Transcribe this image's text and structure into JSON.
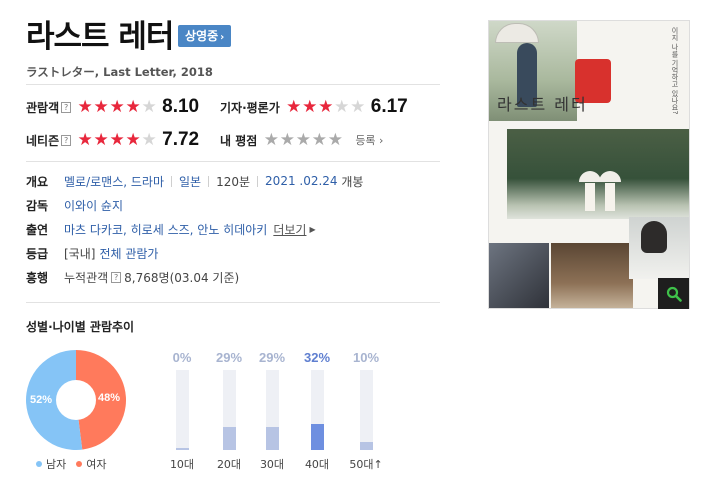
{
  "movie": {
    "title": "라스트 레터",
    "status_badge": "상영중",
    "subtitle": "ラストレター, Last Letter, 2018"
  },
  "ratings": {
    "audience": {
      "label": "관람객",
      "help": "?",
      "score": "8.10",
      "stars_on": 4
    },
    "critics": {
      "label": "기자·평론가",
      "score": "6.17",
      "stars_on": 3
    },
    "netizen": {
      "label": "네티즌",
      "help": "?",
      "score": "7.72",
      "stars_on": 4
    },
    "my": {
      "label": "내 평점",
      "register": "등록 ›"
    }
  },
  "info": {
    "overview": {
      "key": "개요",
      "genres": "멜로/로맨스, 드라마",
      "country": "일본",
      "runtime": "120분",
      "release_date": "2021 .02.24",
      "release_suffix": " 개봉"
    },
    "director": {
      "key": "감독",
      "value": "이와이 슌지"
    },
    "cast": {
      "key": "출연",
      "value": "마츠 다카코, 히로세 스즈, 안노 히데아키",
      "more": "더보기"
    },
    "rating": {
      "key": "등급",
      "prefix": "[국내]",
      "value": "전체 관람가"
    },
    "boxoffice": {
      "key": "흥행",
      "label": "누적관객",
      "help": "?",
      "value": "8,768명(03.04 기준)"
    }
  },
  "poster": {
    "title": "라스트 레터",
    "vertical_text": "이지 나를 기억하고 있나요?",
    "zoom_icon": "search-icon"
  },
  "demographics": {
    "title": "성별·나이별 관람추이",
    "gender": {
      "male_label": "남자",
      "female_label": "여자",
      "male_pct": "52%",
      "female_pct": "48%"
    },
    "colors": {
      "male": "#85c4f6",
      "female": "#ff7a5c",
      "age_bar": "#b7c4e4",
      "age_bar_highlight": "#6e8fe0"
    }
  },
  "chart_data": [
    {
      "type": "pie",
      "categories": [
        "남자",
        "여자"
      ],
      "values": [
        52,
        48
      ],
      "title": "",
      "legend": "bottom"
    },
    {
      "type": "bar",
      "categories": [
        "10대",
        "20대",
        "30대",
        "40대",
        "50대↑"
      ],
      "values": [
        0,
        29,
        29,
        32,
        10
      ],
      "labels": [
        "0%",
        "29%",
        "29%",
        "32%",
        "10%"
      ],
      "highlight": "40대",
      "ylim": [
        0,
        100
      ],
      "title": ""
    }
  ]
}
